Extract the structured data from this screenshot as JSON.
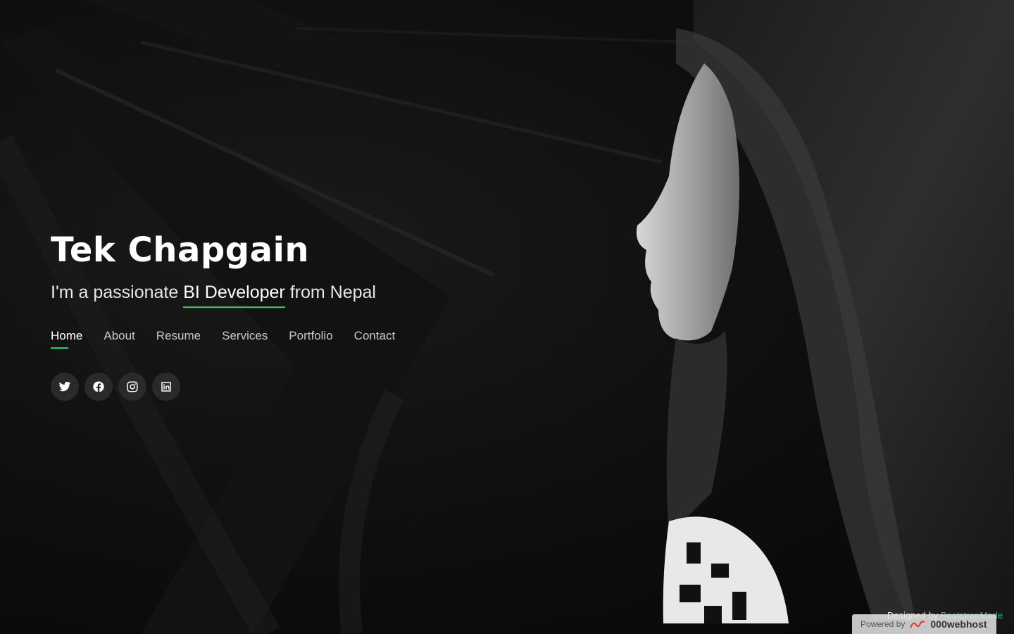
{
  "hero": {
    "name": "Tek Chapgain",
    "tagline_prefix": "I'm a passionate",
    "tagline_role": "BI Developer",
    "tagline_suffix": "from Nepal"
  },
  "nav": {
    "items": [
      {
        "label": "Home",
        "active": true
      },
      {
        "label": "About"
      },
      {
        "label": "Resume"
      },
      {
        "label": "Services"
      },
      {
        "label": "Portfolio"
      },
      {
        "label": "Contact"
      }
    ]
  },
  "socials": [
    "twitter-icon",
    "facebook-icon",
    "instagram-icon",
    "linkedin-icon"
  ],
  "footer": {
    "designed_by_prefix": "Designed by",
    "designed_by_link": "BootstrapMade",
    "powered_by": "Powered by",
    "powered_brand": "000webhost"
  },
  "colors": {
    "accent": "#18d26e",
    "background": "#0b0b0b",
    "text": "#ffffff"
  }
}
